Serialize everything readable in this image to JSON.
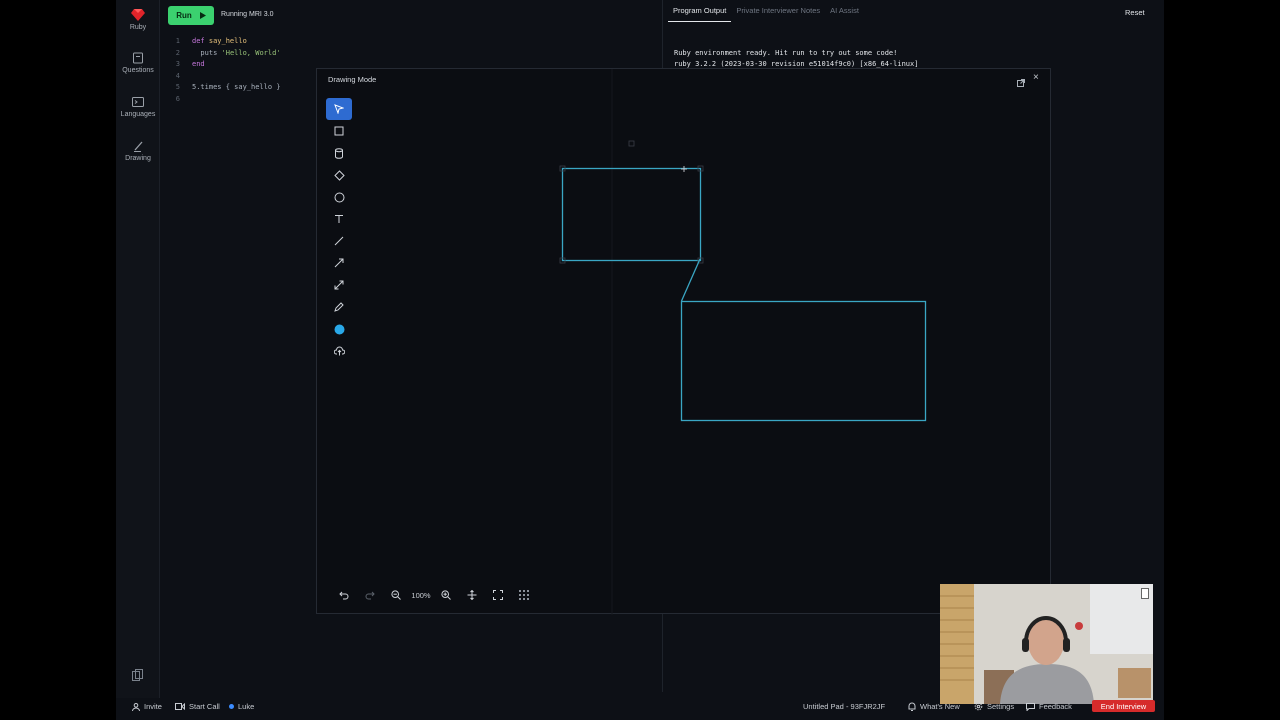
{
  "sidebar": {
    "items": [
      {
        "label": "Ruby",
        "icon": "ruby-icon"
      },
      {
        "label": "Questions",
        "icon": "questions-icon"
      },
      {
        "label": "Languages",
        "icon": "terminal-icon"
      },
      {
        "label": "Drawing",
        "icon": "pencil-icon"
      }
    ]
  },
  "toolbar": {
    "run_label": "Run",
    "runtime_label": "Running MRI 3.0"
  },
  "editor": {
    "lines": [
      {
        "num": "1",
        "text": "def say_hello"
      },
      {
        "num": "2",
        "text": "  puts 'Hello, World'"
      },
      {
        "num": "3",
        "text": "end"
      },
      {
        "num": "4",
        "text": ""
      },
      {
        "num": "5",
        "text": "5.times { say_hello }"
      },
      {
        "num": "6",
        "text": ""
      }
    ]
  },
  "right_panel": {
    "tabs": [
      {
        "label": "Program Output",
        "active": true
      },
      {
        "label": "Private Interviewer Notes",
        "active": false
      },
      {
        "label": "AI Assist",
        "active": false
      }
    ],
    "reset_label": "Reset",
    "output_lines": [
      "Ruby environment ready. Hit run to try out some code!",
      "ruby 3.2.2 (2023-03-30 revision e51014f9c0) [x86_64-linux]"
    ]
  },
  "drawing_modal": {
    "title": "Drawing Mode",
    "tools": [
      "pointer-tool-icon",
      "rectangle-tool-icon",
      "cylinder-tool-icon",
      "diamond-tool-icon",
      "ellipse-tool-icon",
      "text-tool-icon",
      "line-tool-icon",
      "arrow-tool-icon",
      "connector-tool-icon",
      "pen-tool-icon",
      "color-picker-icon",
      "upload-tool-icon"
    ],
    "active_tool": "pointer-tool-icon",
    "accent_color": "#2e6bd1",
    "stroke_color": "#3aa6c4",
    "color_swatch": "#29a8e8",
    "zoom_label": "100%"
  },
  "footer": {
    "invite_label": "Invite",
    "start_call_label": "Start Call",
    "user_label": "Luke",
    "pad_label": "Untitled Pad - 93FJR2JF",
    "whats_new_label": "What's New",
    "settings_label": "Settings",
    "feedback_label": "Feedback",
    "end_interview_label": "End Interview",
    "end_color": "#d62b2b"
  }
}
